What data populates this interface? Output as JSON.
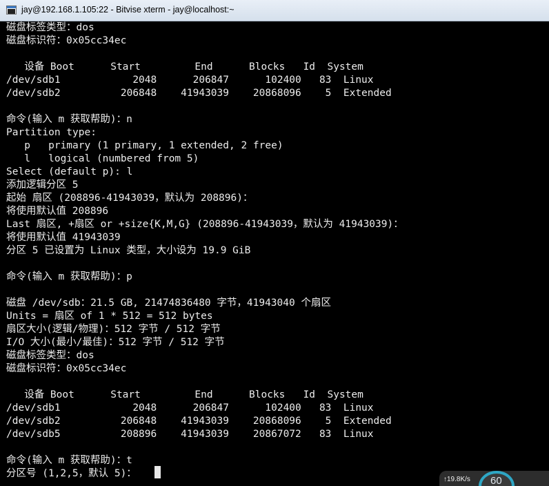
{
  "window": {
    "title": "jay@192.168.1.105:22 - Bitvise xterm - jay@localhost:~",
    "app_icon": "terminal-icon"
  },
  "terminal": {
    "foreground": "#ececec",
    "background": "#000000",
    "lines": [
      "磁盘标签类型：dos",
      "磁盘标识符：0x05cc34ec",
      "",
      "   设备 Boot      Start         End      Blocks   Id  System",
      "/dev/sdb1            2048      206847      102400   83  Linux",
      "/dev/sdb2          206848    41943039    20868096    5  Extended",
      "",
      "命令(输入 m 获取帮助)：n",
      "Partition type:",
      "   p   primary (1 primary, 1 extended, 2 free)",
      "   l   logical (numbered from 5)",
      "Select (default p): l",
      "添加逻辑分区 5",
      "起始 扇区 (208896-41943039，默认为 208896)：",
      "将使用默认值 208896",
      "Last 扇区, +扇区 or +size{K,M,G} (208896-41943039，默认为 41943039)：",
      "将使用默认值 41943039",
      "分区 5 已设置为 Linux 类型，大小设为 19.9 GiB",
      "",
      "命令(输入 m 获取帮助)：p",
      "",
      "磁盘 /dev/sdb：21.5 GB, 21474836480 字节，41943040 个扇区",
      "Units = 扇区 of 1 * 512 = 512 bytes",
      "扇区大小(逻辑/物理)：512 字节 / 512 字节",
      "I/O 大小(最小/最佳)：512 字节 / 512 字节",
      "磁盘标签类型：dos",
      "磁盘标识符：0x05cc34ec",
      "",
      "   设备 Boot      Start         End      Blocks   Id  System",
      "/dev/sdb1            2048      206847      102400   83  Linux",
      "/dev/sdb2          206848    41943039    20868096    5  Extended",
      "/dev/sdb5          208896    41943039    20867072   83  Linux",
      "",
      "命令(输入 m 获取帮助)：t",
      "分区号 (1,2,5，默认 5)："
    ]
  },
  "net_widget": {
    "speed": "↑19.8K/s",
    "gauge_value": "60",
    "accent": "#2ea6c4"
  }
}
